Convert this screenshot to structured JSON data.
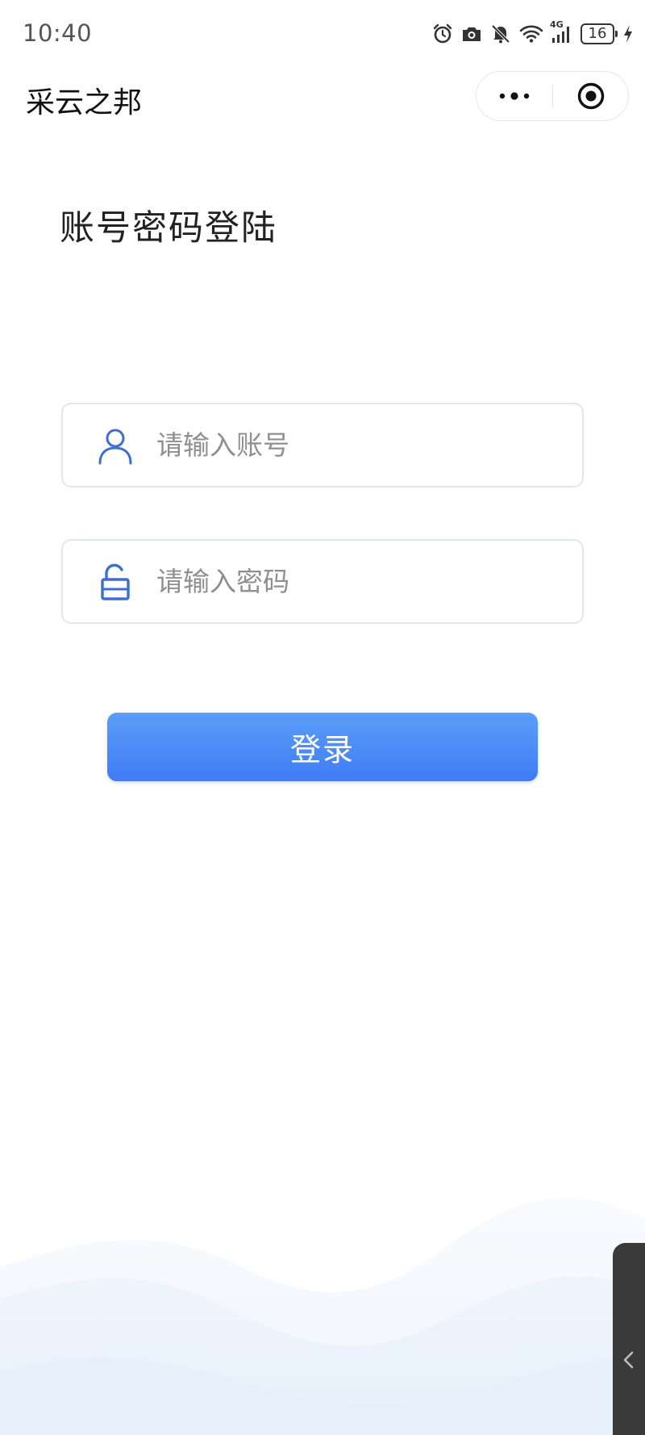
{
  "status_bar": {
    "time": "10:40",
    "network": "4G",
    "battery": "16",
    "icons": [
      "alarm-icon",
      "camera-icon",
      "bell-off-icon",
      "wifi-icon",
      "signal-icon",
      "battery-icon",
      "charging-icon"
    ]
  },
  "header": {
    "title": "采云之邦",
    "capsule": {
      "more_icon": "more-dots-icon",
      "close_icon": "target-circle-icon"
    }
  },
  "login": {
    "heading": "账号密码登陆",
    "account": {
      "placeholder": "请输入账号",
      "value": "",
      "icon": "user-icon"
    },
    "password": {
      "placeholder": "请输入密码",
      "value": "",
      "icon": "lock-open-icon"
    },
    "submit_label": "登录"
  },
  "colors": {
    "accent": "#4080f6",
    "icon_blue": "#3d6fcf",
    "field_border": "#dfe8f1",
    "side_handle": "#3a3a3a"
  },
  "side_handle": {
    "icon": "chevron-left-icon"
  }
}
